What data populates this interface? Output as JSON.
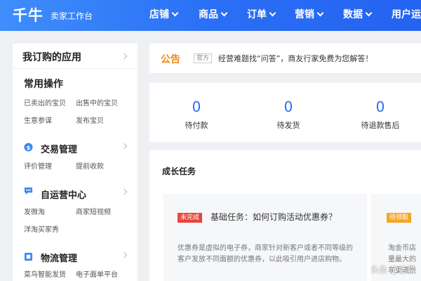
{
  "header": {
    "logo": "千牛",
    "subtitle": "卖家工作台",
    "nav": [
      "店铺",
      "商品",
      "订单",
      "营销",
      "数据",
      "用户运"
    ]
  },
  "sidebar": {
    "title": "我订购的应用",
    "sections": [
      {
        "title": "常用操作",
        "icon": "",
        "links": [
          "已卖出的宝贝",
          "出售中的宝贝",
          "生意参谋",
          "发布宝贝"
        ]
      },
      {
        "title": "交易管理",
        "icon": "yuan-icon",
        "links": [
          "评价管理",
          "提前收款"
        ]
      },
      {
        "title": "自运营中心",
        "icon": "chat-bubble-icon",
        "links": [
          "发微淘",
          "商家短视频",
          "洋淘买家秀"
        ]
      },
      {
        "title": "物流管理",
        "icon": "logistics-icon",
        "links": [
          "菜鸟智能发货",
          "电子面单平台"
        ]
      }
    ]
  },
  "notice": {
    "label": "公告",
    "tag": "官方",
    "text": "经营难题找“问答”，商友行家免费为您解答！"
  },
  "stats": [
    {
      "value": "0",
      "label": "待付款"
    },
    {
      "value": "0",
      "label": "待发货"
    },
    {
      "value": "0",
      "label": "待退款售后"
    }
  ],
  "growth": {
    "title": "成长任务",
    "tasks": [
      {
        "badge": "未完成",
        "badge_color": "#e8453c",
        "title": "基础任务：如何订购活动优惠券？",
        "desc": "优惠券是虚拟的电子券，商家针对新客户或者不同等级的客户发放不同面额的优惠券，以此吸引用户进店购物。"
      },
      {
        "badge": "待领取",
        "badge_color": "#f5a623",
        "title": "",
        "desc_lines": [
          "淘金币店",
          "量最大的",
          "享受流量"
        ]
      }
    ]
  },
  "watermark": "头条 @结骥",
  "colors": {
    "header": "#2a6ff5",
    "accent": "#2a6ff5",
    "notice": "#f08a14"
  }
}
